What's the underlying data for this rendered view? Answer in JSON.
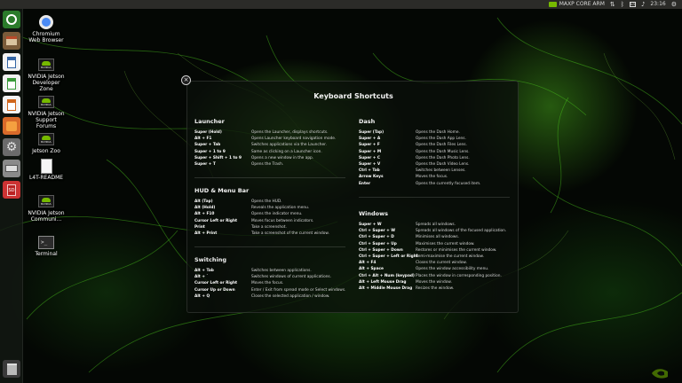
{
  "top_panel": {
    "device": "MAXP CORE ARM",
    "input_indicator": "En",
    "time": "23:16"
  },
  "launcher": {
    "items": [
      {
        "name": "ubuntu-dash-icon"
      },
      {
        "name": "files-icon"
      },
      {
        "name": "libreoffice-writer-icon"
      },
      {
        "name": "libreoffice-calc-icon"
      },
      {
        "name": "libreoffice-impress-icon"
      },
      {
        "name": "software-center-icon"
      },
      {
        "name": "system-settings-icon"
      },
      {
        "name": "drive-icon"
      },
      {
        "name": "sd-card-icon"
      },
      {
        "name": "trash-icon"
      }
    ],
    "sd_label": "SD"
  },
  "desktop": {
    "icons": [
      {
        "label": "Chromium Web Browser",
        "icon": "chromium-icon"
      },
      {
        "label": "NVIDIA Jetson Developer Zone",
        "icon": "nvidia-icon"
      },
      {
        "label": "NVIDIA Jetson Support Forums",
        "icon": "nvidia-icon"
      },
      {
        "label": "Jetson Zoo",
        "icon": "nvidia-icon"
      },
      {
        "label": "L4T-README",
        "icon": "text-file-icon"
      },
      {
        "label": "NVIDIA Jetson Communi...",
        "icon": "nvidia-icon"
      },
      {
        "label": "Terminal",
        "icon": "terminal-icon"
      }
    ],
    "nvidia_word": "NVIDIA"
  },
  "shortcuts": {
    "title": "Keyboard Shortcuts",
    "close_glyph": "×",
    "launcher": {
      "title": "Launcher",
      "rows": [
        {
          "key": "Super (Hold)",
          "desc": "Opens the Launcher, displays shortcuts."
        },
        {
          "key": "Alt + F1",
          "desc": "Opens Launcher keyboard navigation mode."
        },
        {
          "key": "Super + Tab",
          "desc": "Switches applications via the Launcher."
        },
        {
          "key": "Super + 1 to 9",
          "desc": "Same as clicking on a Launcher icon."
        },
        {
          "key": "Super + Shift + 1 to 9",
          "desc": "Opens a new window in the app."
        },
        {
          "key": "Super + T",
          "desc": "Opens the Trash."
        }
      ]
    },
    "hud": {
      "title": "HUD & Menu Bar",
      "rows": [
        {
          "key": "Alt (Tap)",
          "desc": "Opens the HUD."
        },
        {
          "key": "Alt (Hold)",
          "desc": "Reveals the application menu."
        },
        {
          "key": "Alt + F10",
          "desc": "Opens the indicator menu."
        },
        {
          "key": "Cursor Left or Right",
          "desc": "Moves focus between indicators."
        },
        {
          "key": "Print",
          "desc": "Take a screenshot."
        },
        {
          "key": "Alt + Print",
          "desc": "Take a screenshot of the current window."
        }
      ]
    },
    "switching": {
      "title": "Switching",
      "rows": [
        {
          "key": "Alt + Tab",
          "desc": "Switches between applications."
        },
        {
          "key": "Alt + `",
          "desc": "Switches windows of current applications."
        },
        {
          "key": "Cursor Left or Right",
          "desc": "Moves the focus."
        },
        {
          "key": "Cursor Up or Down",
          "desc": "Enter / Exit from spread mode or Select windows."
        },
        {
          "key": "Alt + Q",
          "desc": "Closes the selected application / window."
        }
      ]
    },
    "dash": {
      "title": "Dash",
      "rows": [
        {
          "key": "Super (Tap)",
          "desc": "Opens the Dash Home."
        },
        {
          "key": "Super + A",
          "desc": "Opens the Dash App Lens."
        },
        {
          "key": "Super + F",
          "desc": "Opens the Dash Files Lens."
        },
        {
          "key": "Super + M",
          "desc": "Opens the Dash Music Lens."
        },
        {
          "key": "Super + C",
          "desc": "Opens the Dash Photo Lens."
        },
        {
          "key": "Super + V",
          "desc": "Opens the Dash Video Lens."
        },
        {
          "key": "Ctrl + Tab",
          "desc": "Switches between Lenses."
        },
        {
          "key": "Arrow Keys",
          "desc": "Moves the focus."
        },
        {
          "key": "Enter",
          "desc": "Opens the currently focused item."
        }
      ]
    },
    "windows": {
      "title": "Windows",
      "rows": [
        {
          "key": "Super + W",
          "desc": "Spreads all windows."
        },
        {
          "key": "Ctrl + Super + W",
          "desc": "Spreads all windows of the focused application."
        },
        {
          "key": "Ctrl + Super + D",
          "desc": "Minimises all windows."
        },
        {
          "key": "Ctrl + Super + Up",
          "desc": "Maximises the current window."
        },
        {
          "key": "Ctrl + Super + Down",
          "desc": "Restores or minimises the current window."
        },
        {
          "key": "Ctrl + Super + Left or Right",
          "desc": "Semi-maximise the current window."
        },
        {
          "key": "Alt + F4",
          "desc": "Closes the current window."
        },
        {
          "key": "Alt + Space",
          "desc": "Opens the window accessibility menu."
        },
        {
          "key": "Ctrl + Alt + Num (keypad)",
          "desc": "Places the window in corresponding position."
        },
        {
          "key": "Alt + Left Mouse Drag",
          "desc": "Moves the window."
        },
        {
          "key": "Alt + Middle Mouse Drag",
          "desc": "Resizes the window."
        }
      ]
    }
  },
  "colors": {
    "accent": "#76b900",
    "panel": "#2b2b28"
  }
}
